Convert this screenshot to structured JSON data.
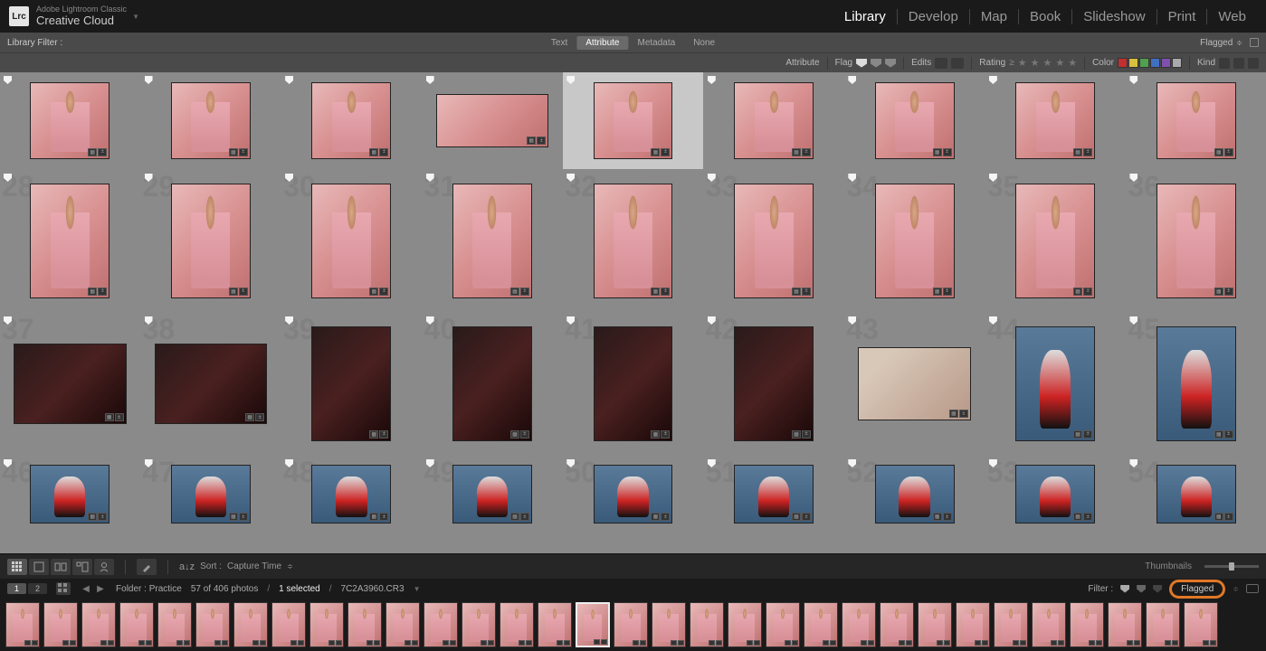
{
  "header": {
    "logo": "Lrc",
    "brand_small": "Adobe Lightroom Classic",
    "brand_big": "Creative Cloud"
  },
  "modules": [
    {
      "label": "Library",
      "active": true
    },
    {
      "label": "Develop",
      "active": false
    },
    {
      "label": "Map",
      "active": false
    },
    {
      "label": "Book",
      "active": false
    },
    {
      "label": "Slideshow",
      "active": false
    },
    {
      "label": "Print",
      "active": false
    },
    {
      "label": "Web",
      "active": false
    }
  ],
  "filter_bar": {
    "label": "Library Filter :",
    "tabs": [
      {
        "label": "Text",
        "active": false
      },
      {
        "label": "Attribute",
        "active": true
      },
      {
        "label": "Metadata",
        "active": false
      },
      {
        "label": "None",
        "active": false
      }
    ],
    "preset": "Flagged"
  },
  "attr_bar": {
    "attribute": "Attribute",
    "flag": "Flag",
    "edits": "Edits",
    "rating": "Rating",
    "color": "Color",
    "kind": "Kind",
    "colors": [
      "#c03030",
      "#d8c040",
      "#50a050",
      "#4070c0",
      "#8050b0",
      "#aaaaaa"
    ]
  },
  "grid": {
    "rows": [
      {
        "type": "r1",
        "cells": [
          {
            "n": ""
          },
          {
            "n": ""
          },
          {
            "n": ""
          },
          {
            "n": "",
            "wide": false
          },
          {
            "n": "",
            "sel": true
          },
          {
            "n": ""
          },
          {
            "n": ""
          },
          {
            "n": ""
          },
          {
            "n": ""
          }
        ]
      },
      {
        "type": "r2",
        "cells": [
          {
            "n": "28"
          },
          {
            "n": "29"
          },
          {
            "n": "30"
          },
          {
            "n": "31"
          },
          {
            "n": "32"
          },
          {
            "n": "33"
          },
          {
            "n": "34"
          },
          {
            "n": "35"
          },
          {
            "n": "36"
          }
        ]
      },
      {
        "type": "r3",
        "cells": [
          {
            "n": "37",
            "style": "darkwide"
          },
          {
            "n": "38",
            "style": "darkwide"
          },
          {
            "n": "39",
            "style": "dark"
          },
          {
            "n": "40",
            "style": "dark"
          },
          {
            "n": "41",
            "style": "dark"
          },
          {
            "n": "42",
            "style": "dark"
          },
          {
            "n": "43",
            "style": "wide2"
          },
          {
            "n": "44",
            "style": "blue"
          },
          {
            "n": "45",
            "style": "blue"
          }
        ]
      },
      {
        "type": "r4",
        "cells": [
          {
            "n": "46",
            "style": "blue"
          },
          {
            "n": "47",
            "style": "blue"
          },
          {
            "n": "48",
            "style": "blue"
          },
          {
            "n": "49",
            "style": "blue"
          },
          {
            "n": "50",
            "style": "blue"
          },
          {
            "n": "51",
            "style": "blue"
          },
          {
            "n": "52",
            "style": "blue"
          },
          {
            "n": "53",
            "style": "blue"
          },
          {
            "n": "54",
            "style": "blue"
          }
        ]
      }
    ]
  },
  "toolbar": {
    "sort_label": "Sort :",
    "sort_value": "Capture Time",
    "thumbnails": "Thumbnails"
  },
  "status": {
    "tabs": [
      "1",
      "2"
    ],
    "folder_label": "Folder : Practice",
    "count": "57 of 406 photos",
    "selected": "1 selected",
    "filename": "7C2A3960.CR3",
    "filter_label": "Filter :",
    "flagged": "Flagged"
  },
  "filmstrip": {
    "count": 32,
    "selected_index": 15
  }
}
